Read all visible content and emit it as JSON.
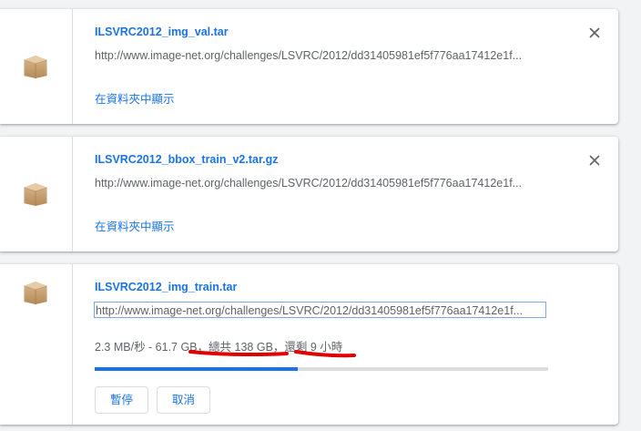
{
  "colors": {
    "accent": "#1a73e8",
    "text_secondary": "#5f6368",
    "annotation": "#e00000"
  },
  "downloads": [
    {
      "filename": "ILSVRC2012_img_val.tar",
      "url": "http://www.image-net.org/challenges/LSVRC/2012/dd31405981ef5f776aa17412e1f...",
      "show_in_folder": "在資料夾中顯示",
      "icon": "package-icon",
      "close_icon": "close-icon"
    },
    {
      "filename": "ILSVRC2012_bbox_train_v2.tar.gz",
      "url": "http://www.image-net.org/challenges/LSVRC/2012/dd31405981ef5f776aa17412e1f...",
      "show_in_folder": "在資料夾中顯示",
      "icon": "package-icon",
      "close_icon": "close-icon"
    },
    {
      "filename": "ILSVRC2012_img_train.tar",
      "url": "http://www.image-net.org/challenges/LSVRC/2012/dd31405981ef5f776aa17412e1f...",
      "status": "2.3 MB/秒 - 61.7 GB，總共 138 GB，還剩 9 小時",
      "progress": 0.447,
      "pause_label": "暫停",
      "cancel_label": "取消",
      "icon": "package-icon"
    }
  ]
}
